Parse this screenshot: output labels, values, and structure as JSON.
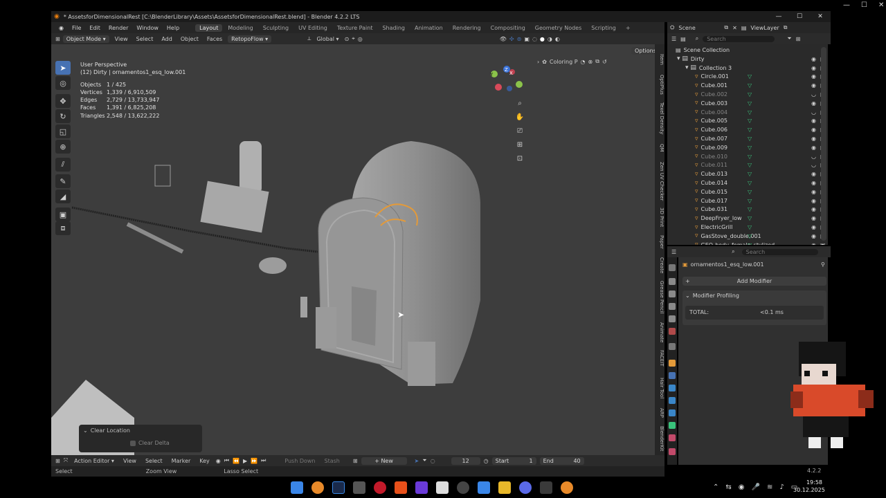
{
  "window": {
    "title": "* AssetsforDimensionalRest [C:\\BlenderLibrary\\Assets\\AssetsforDimensionalRest.blend] - Blender 4.2.2 LTS",
    "controls": [
      "—",
      "☐",
      "✕"
    ]
  },
  "menu": {
    "items": [
      "File",
      "Edit",
      "Render",
      "Window",
      "Help"
    ],
    "workspaces": [
      "Layout",
      "Modeling",
      "Sculpting",
      "UV Editing",
      "Texture Paint",
      "Shading",
      "Animation",
      "Rendering",
      "Compositing",
      "Geometry Nodes",
      "Scripting"
    ],
    "active_workspace": "Layout",
    "add_tab": "+"
  },
  "top_right": {
    "scene": "Scene",
    "view_layer": "ViewLayer"
  },
  "viewport_header": {
    "mode": "Object Mode",
    "menus": [
      "View",
      "Select",
      "Add",
      "Object",
      "Faces",
      "RetopoFlow"
    ],
    "orientation": "Global",
    "options": "Options",
    "coloring": "Coloring P"
  },
  "viewport": {
    "view_name": "User Perspective",
    "object_context": "(12) Dirty | ornamentos1_esq_low.001",
    "stats": [
      {
        "label": "Objects",
        "value": "1 / 425"
      },
      {
        "label": "Vertices",
        "value": "1,339 / 6,910,509"
      },
      {
        "label": "Edges",
        "value": "2,729 / 13,733,947"
      },
      {
        "label": "Faces",
        "value": "1,391 / 6,825,208"
      },
      {
        "label": "Triangles",
        "value": "2,548 / 13,622,222"
      }
    ]
  },
  "side_tabs": [
    "Item",
    "OptiPlus",
    "Texel Density",
    "QM",
    "Zen UV Checker",
    "3D Print",
    "Paper",
    "Create",
    "Grease Pencil",
    "Animate",
    "FACEIT",
    "Hair Tool",
    "ARP",
    "BlenderKit"
  ],
  "gizmo_axes": {
    "x": "X",
    "y": "Y",
    "z": "Z"
  },
  "redo_panel": {
    "title": "Clear Location",
    "checkbox_label": "Clear Delta"
  },
  "timeline": {
    "editor": "Action Editor",
    "menus": [
      "View",
      "Select",
      "Marker",
      "Key"
    ],
    "push_down": "Push Down",
    "stash": "Stash",
    "new_label": "New",
    "frame": "12",
    "start_label": "Start",
    "start": "1",
    "end_label": "End",
    "end": "40"
  },
  "status_bar": {
    "items": [
      "Select",
      "Zoom View",
      "Lasso Select"
    ],
    "version": "4.2.2"
  },
  "outliner": {
    "search_placeholder": "Search",
    "scene_collection": "Scene Collection",
    "rows": [
      {
        "name": "Dirty",
        "level": 1,
        "dim": false
      },
      {
        "name": "Collection 3",
        "level": 2,
        "dim": false
      },
      {
        "name": "Circle.001",
        "level": 3,
        "dim": false
      },
      {
        "name": "Cube.001",
        "level": 3,
        "dim": false
      },
      {
        "name": "Cube.002",
        "level": 3,
        "dim": true
      },
      {
        "name": "Cube.003",
        "level": 3,
        "dim": false
      },
      {
        "name": "Cube.004",
        "level": 3,
        "dim": true
      },
      {
        "name": "Cube.005",
        "level": 3,
        "dim": false
      },
      {
        "name": "Cube.006",
        "level": 3,
        "dim": false
      },
      {
        "name": "Cube.007",
        "level": 3,
        "dim": false
      },
      {
        "name": "Cube.009",
        "level": 3,
        "dim": false
      },
      {
        "name": "Cube.010",
        "level": 3,
        "dim": true
      },
      {
        "name": "Cube.011",
        "level": 3,
        "dim": true
      },
      {
        "name": "Cube.013",
        "level": 3,
        "dim": false
      },
      {
        "name": "Cube.014",
        "level": 3,
        "dim": false
      },
      {
        "name": "Cube.015",
        "level": 3,
        "dim": false
      },
      {
        "name": "Cube.017",
        "level": 3,
        "dim": false
      },
      {
        "name": "Cube.031",
        "level": 3,
        "dim": false
      },
      {
        "name": "DeepFryer_low",
        "level": 3,
        "dim": false
      },
      {
        "name": "ElectricGrill",
        "level": 3,
        "dim": false
      },
      {
        "name": "GasStove_double.001",
        "level": 3,
        "dim": false
      },
      {
        "name": "GEO-body_female_stylized",
        "level": 3,
        "dim": false
      }
    ]
  },
  "properties": {
    "search_placeholder": "Search",
    "object_name": "ornamentos1_esq_low.001",
    "add_modifier": "Add Modifier",
    "panel_title": "Modifier Profiling",
    "total_label": "TOTAL:",
    "total_value": "<0.1 ms"
  },
  "taskbar": {
    "time": "19:58",
    "date": "30.12.2025"
  },
  "colors": {
    "accent": "#4772b3",
    "selection": "#e39a3a",
    "mesh_icon": "#39c27b",
    "viewport_bg": "#3d3d3d"
  }
}
